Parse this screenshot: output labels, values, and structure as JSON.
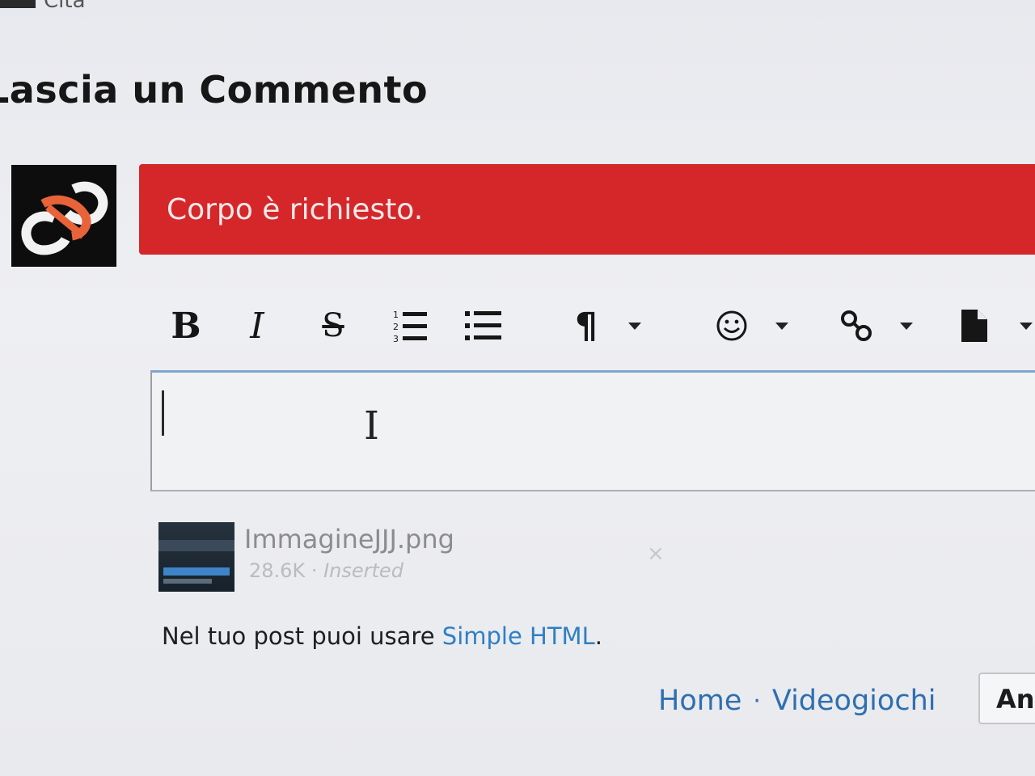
{
  "top": {
    "cita_label": "Cita"
  },
  "comment_form": {
    "heading": "Lascia un Commento",
    "alert_message": "Corpo è richiesto.",
    "toolbar": {
      "bold_glyph": "B",
      "italic_glyph": "I",
      "strike_glyph": "S",
      "paragraph_glyph": "¶",
      "buttons": [
        "bold",
        "italic",
        "strikethrough",
        "ordered-list",
        "unordered-list",
        "paragraph",
        "emoji",
        "link",
        "file"
      ]
    },
    "editor_value": "",
    "attachment": {
      "filename": "ImmagineJJJ.png",
      "size": "28.6K",
      "status": "Inserted",
      "remove_glyph": "×"
    },
    "html_note": {
      "prefix": "Nel tuo post puoi usare ",
      "link": "Simple HTML",
      "suffix": "."
    }
  },
  "footer": {
    "nav": [
      "Home",
      "Videogiochi"
    ],
    "separator": "·",
    "language_button": "An"
  },
  "colors": {
    "alert_bg": "#d5272a",
    "link": "#2f7fc4",
    "editor_focus": "#7fa3cf"
  }
}
